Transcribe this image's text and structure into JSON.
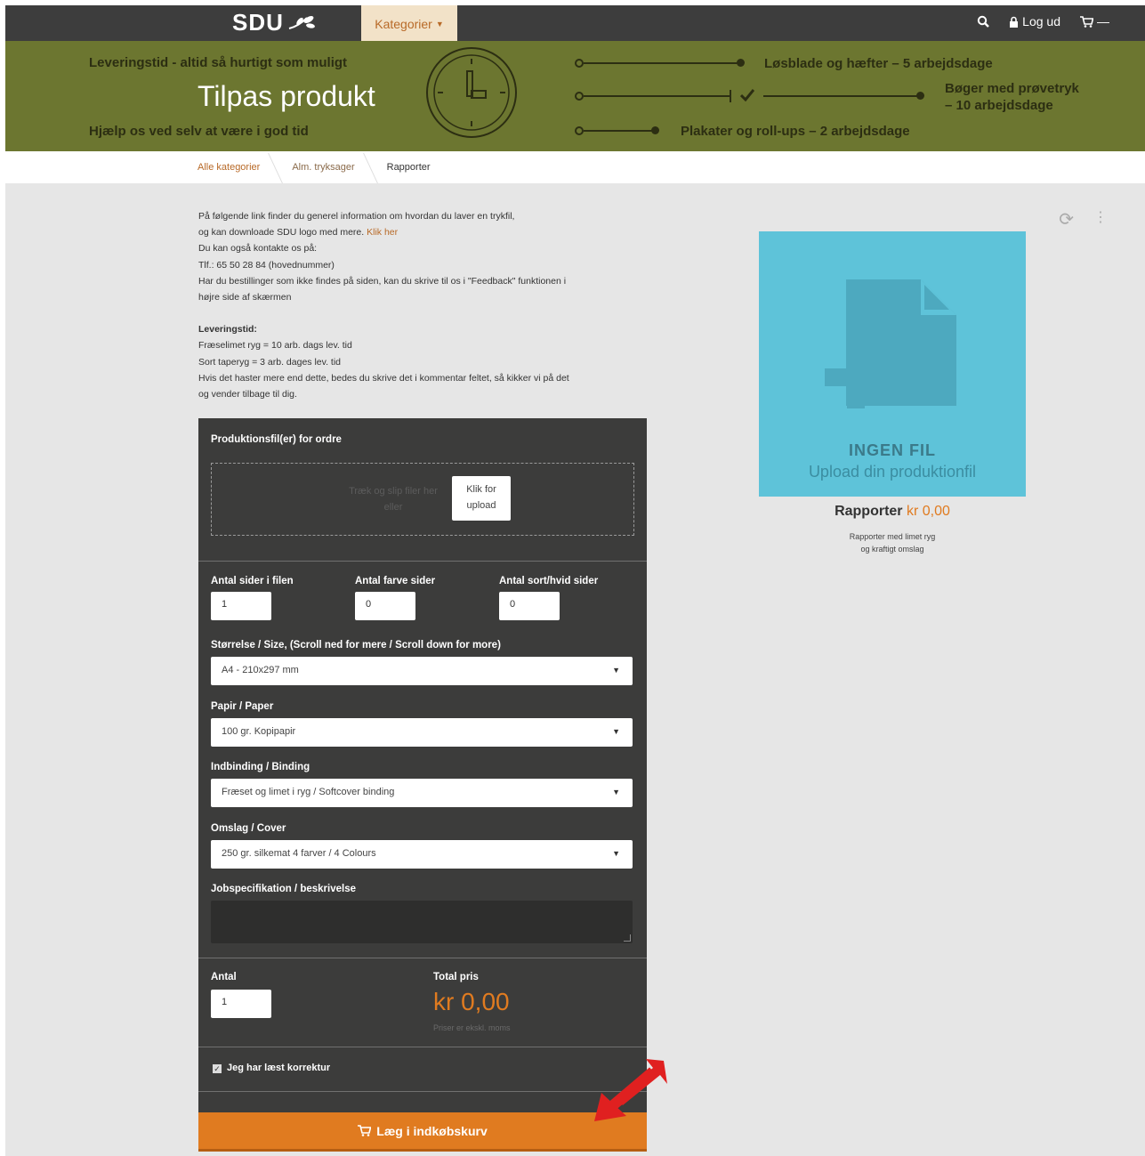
{
  "nav": {
    "logo": "SDU",
    "category_button": "Kategorier",
    "logout": "Log ud",
    "cart_count": "—"
  },
  "banner": {
    "top_left": "Leveringstid - altid så hurtigt som muligt",
    "title": "Tilpas produkt",
    "bottom_left": "Hjælp os ved selv at være i god tid",
    "line1": "Løsblade og hæfter – 5 arbejdsdage",
    "line2a": "Bøger med prøvetryk",
    "line2b": "– 10 arbejdsdage",
    "line3": "Plakater og roll-ups – 2 arbejdsdage"
  },
  "breadcrumb": [
    "Alle kategorier",
    "Alm. tryksager",
    "Rapporter"
  ],
  "info": {
    "p1_line1": "På følgende link finder du generel information om hvordan du laver en trykfil,",
    "p1_line2": "og kan downloade SDU logo med mere. ",
    "p1_link": "Klik her",
    "p1_line3": "Du kan også kontakte os på:",
    "p1_line4": "Tlf.: 65 50 28 84 (hovednummer)",
    "p1_line5": "Har du bestillinger som ikke findes på siden, kan du skrive til os i \"Feedback\" funktionen i",
    "p1_line6": "højre side af skærmen",
    "p2_heading": "Leveringstid:",
    "p2_line1": "Fræselimet ryg = 10 arb. dags lev. tid",
    "p2_line2": "Sort taperyg = 3 arb. dages lev. tid",
    "p2_line3": "Hvis det haster mere end dette, bedes du skrive det i kommentar feltet, så kikker vi på det",
    "p2_line4": "og vender tilbage til dig."
  },
  "preview": {
    "no_file": "INGEN FIL",
    "upload": "Upload din produktionfil",
    "product_name": "Rapporter",
    "product_price": "kr 0,00",
    "desc_line1": "Rapporter med limet ryg",
    "desc_line2": "og kraftigt omslag"
  },
  "form": {
    "files_label": "Produktionsfil(er) for ordre",
    "drop_text_line1": "Træk og slip filer her",
    "drop_text_line2": "eller",
    "upload_btn_line1": "Klik for",
    "upload_btn_line2": "upload",
    "pages_label": "Antal sider i filen",
    "pages_value": "1",
    "color_pages_label": "Antal farve sider",
    "color_pages_value": "0",
    "bw_pages_label": "Antal sort/hvid sider",
    "bw_pages_value": "0",
    "size_label": "Størrelse / Size, (Scroll ned for mere / Scroll down for more)",
    "size_value": "A4 - 210x297 mm",
    "paper_label": "Papir / Paper",
    "paper_value": "100 gr. Kopipapir",
    "binding_label": "Indbinding / Binding",
    "binding_value": "Fræset og limet i ryg / Softcover binding",
    "cover_label": "Omslag / Cover",
    "cover_value": "250 gr. silkemat 4 farver / 4 Colours",
    "job_label": "Jobspecifikation / beskrivelse",
    "qty_label": "Antal",
    "qty_value": "1",
    "total_label": "Total pris",
    "total_value": "kr 0,00",
    "total_note": "Priser er ekskl. moms",
    "proof_label": "Jeg har læst korrektur",
    "cart_button": "Læg i indkøbskurv"
  },
  "colors": {
    "nav_bg": "#3d3d3d",
    "banner_bg": "#6c7630",
    "accent": "#e07b20",
    "preview_bg": "#5ec3d9",
    "panel_bg": "#3c3c3b"
  }
}
